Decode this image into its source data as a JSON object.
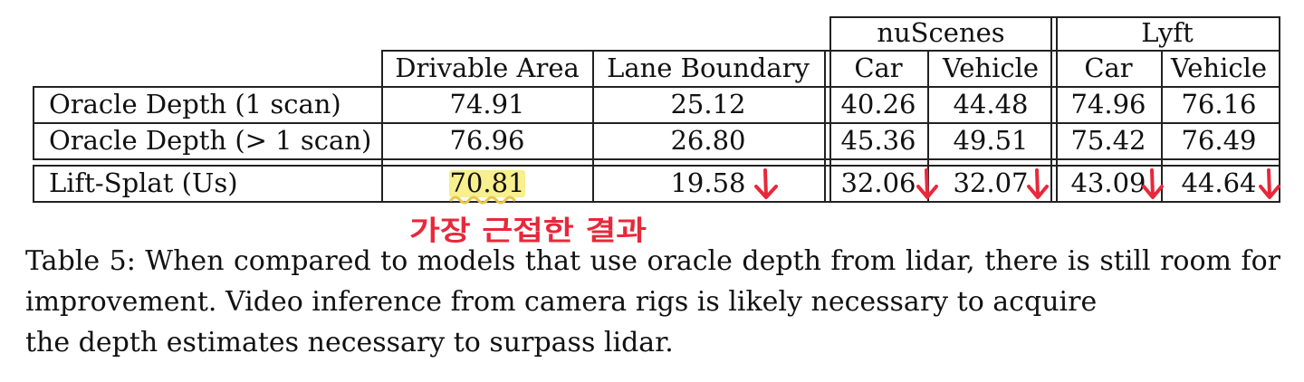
{
  "table": {
    "group_headers": {
      "nuscenes": "nuScenes",
      "lyft": "Lyft"
    },
    "col_headers": {
      "drivable": "Drivable Area",
      "lane": "Lane Boundary",
      "nus_car": "Car",
      "nus_vehicle": "Vehicle",
      "lyft_car": "Car",
      "lyft_vehicle": "Vehicle"
    },
    "rows": [
      {
        "label": "Oracle Depth (1 scan)",
        "values": [
          "74.91",
          "25.12",
          "40.26",
          "44.48",
          "74.96",
          "76.16"
        ]
      },
      {
        "label": "Oracle Depth (> 1 scan)",
        "values": [
          "76.96",
          "26.80",
          "45.36",
          "49.51",
          "75.42",
          "76.49"
        ]
      },
      {
        "label": "Lift-Splat (Us)",
        "values": [
          "70.81",
          "19.58",
          "32.06",
          "32.07",
          "43.09",
          "44.64"
        ]
      }
    ]
  },
  "annotation": {
    "handwritten_note": "가장 근접한 결과",
    "highlight_color": "#f7ec7a",
    "arrow_color": "#e8283b",
    "squiggle_color": "#e8c64a"
  },
  "caption": {
    "line_full": "Table 5: When compared to models that use oracle depth from lidar, there is still room for improvement. Video inference from camera rigs is likely necessary to acquire",
    "line_last": "the depth estimates necessary to surpass lidar."
  }
}
